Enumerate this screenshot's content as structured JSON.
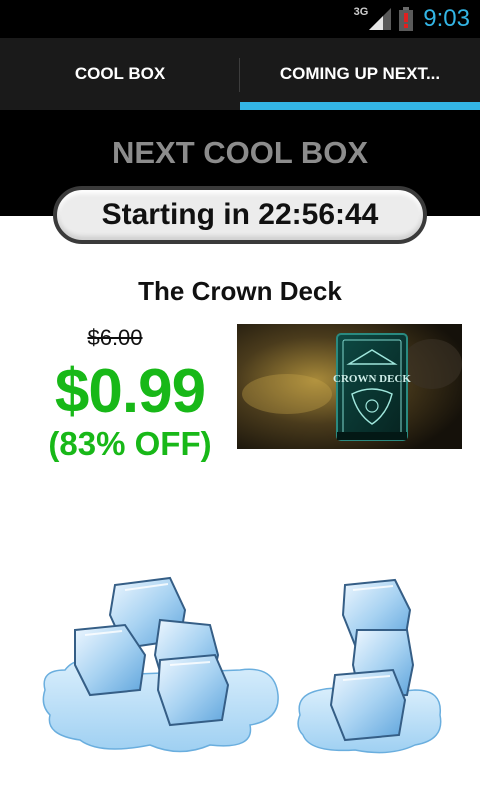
{
  "status_bar": {
    "network": "3G",
    "time": "9:03",
    "icons": [
      "signal-icon",
      "battery-alert-icon"
    ],
    "time_color": "#33b5e5"
  },
  "tabs": [
    {
      "label": "COOL BOX",
      "selected": false
    },
    {
      "label": "COMING UP NEXT...",
      "selected": true
    }
  ],
  "header": {
    "title": "NEXT COOL BOX"
  },
  "countdown": {
    "text": "Starting in 22:56:44"
  },
  "product": {
    "name": "The Crown Deck",
    "original_price": "$6.00",
    "sale_price": "$0.99",
    "discount": "(83% OFF)",
    "image_label": "CROWN DECK",
    "price_color": "#18b818"
  },
  "decorations": [
    "ice-cubes-left-image",
    "ice-cubes-right-image"
  ]
}
